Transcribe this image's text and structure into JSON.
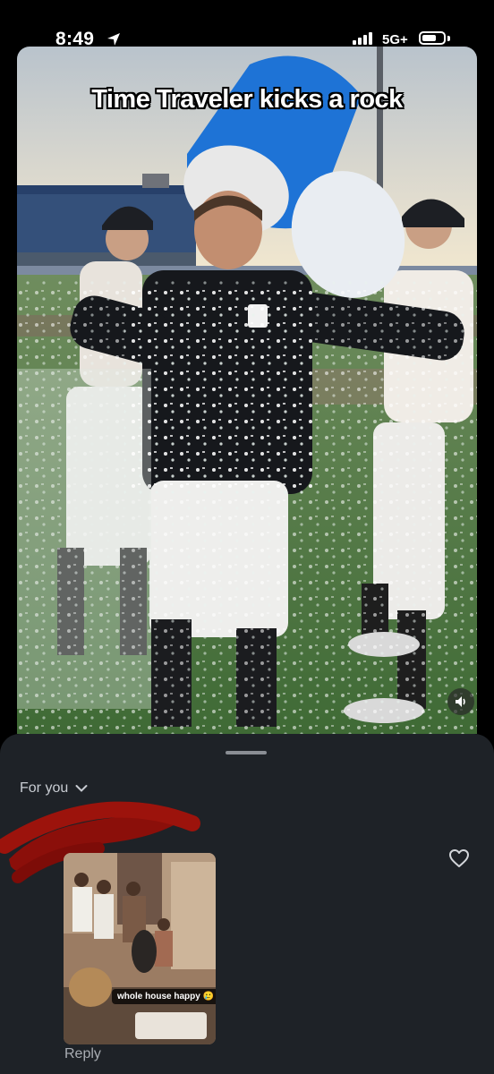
{
  "status_bar": {
    "time": "8:49",
    "network": "5G+",
    "battery_level": 0.7
  },
  "video": {
    "caption": "Time Traveler kicks a rock",
    "mute_icon": "speaker-icon"
  },
  "sheet": {
    "title": "For you",
    "title_icon": "chevron-down-icon",
    "thumbnail_caption": "whole house happy 🥲",
    "like_icon": "heart-outline-icon",
    "reply_label": "Reply"
  },
  "colors": {
    "sheet_background": "#1e2227",
    "redaction": "#8b0f0a",
    "cooler_blue": "#1e73d6"
  }
}
